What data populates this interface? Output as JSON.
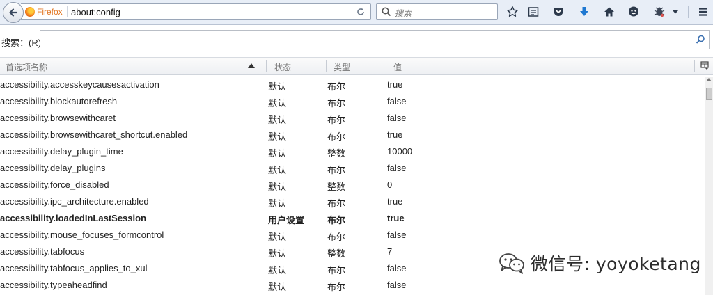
{
  "toolbar": {
    "identity_label": "Firefox",
    "url": "about:config",
    "search_placeholder": "搜索"
  },
  "filter": {
    "label": "搜索：(R)",
    "value": ""
  },
  "columns": {
    "name": "首选项名称",
    "status": "状态",
    "type": "类型",
    "value": "值"
  },
  "rows": [
    {
      "name": "accessibility.accesskeycausesactivation",
      "status": "默认",
      "type": "布尔",
      "value": "true"
    },
    {
      "name": "accessibility.blockautorefresh",
      "status": "默认",
      "type": "布尔",
      "value": "false"
    },
    {
      "name": "accessibility.browsewithcaret",
      "status": "默认",
      "type": "布尔",
      "value": "false"
    },
    {
      "name": "accessibility.browsewithcaret_shortcut.enabled",
      "status": "默认",
      "type": "布尔",
      "value": "true"
    },
    {
      "name": "accessibility.delay_plugin_time",
      "status": "默认",
      "type": "整数",
      "value": "10000"
    },
    {
      "name": "accessibility.delay_plugins",
      "status": "默认",
      "type": "布尔",
      "value": "false"
    },
    {
      "name": "accessibility.force_disabled",
      "status": "默认",
      "type": "整数",
      "value": "0"
    },
    {
      "name": "accessibility.ipc_architecture.enabled",
      "status": "默认",
      "type": "布尔",
      "value": "true"
    },
    {
      "name": "accessibility.loadedInLastSession",
      "status": "用户设置",
      "type": "布尔",
      "value": "true"
    },
    {
      "name": "accessibility.mouse_focuses_formcontrol",
      "status": "默认",
      "type": "布尔",
      "value": "false"
    },
    {
      "name": "accessibility.tabfocus",
      "status": "默认",
      "type": "整数",
      "value": "7"
    },
    {
      "name": "accessibility.tabfocus_applies_to_xul",
      "status": "默认",
      "type": "布尔",
      "value": "false"
    },
    {
      "name": "accessibility.typeaheadfind",
      "status": "默认",
      "type": "布尔",
      "value": "false"
    }
  ],
  "watermark": {
    "text": "微信号: yoyoketang"
  },
  "icons": [
    "back-arrow-icon",
    "firefox-logo-icon",
    "reload-icon",
    "search-icon",
    "bookmark-star-icon",
    "reading-list-icon",
    "pocket-icon",
    "download-icon",
    "home-icon",
    "chat-icon",
    "extension-icon",
    "menu-icon",
    "column-picker-icon"
  ],
  "colors": {
    "toolbar_bg": "#e8eef7",
    "download_blue": "#1f78d1",
    "firefox_orange": "#e1731d"
  }
}
